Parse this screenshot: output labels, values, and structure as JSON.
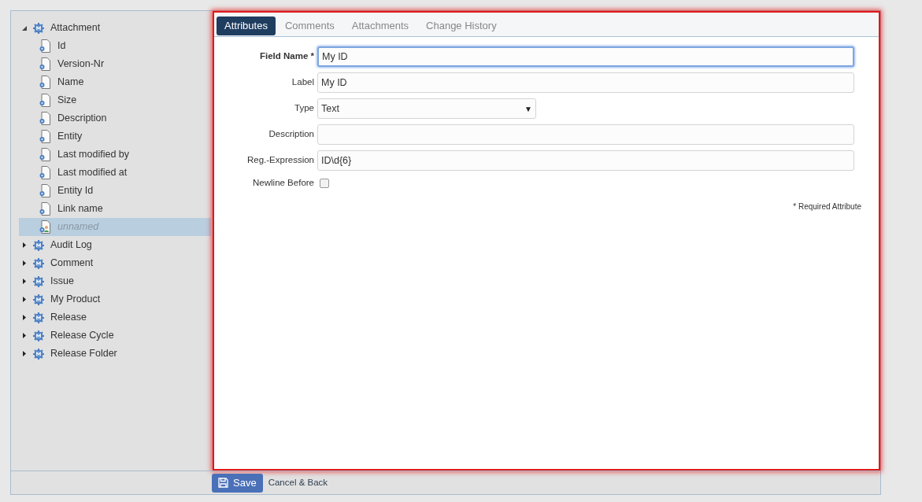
{
  "tree": [
    {
      "label": "Attachment",
      "kind": "entity",
      "expanded": true,
      "selected": false,
      "children": [
        {
          "label": "Id",
          "kind": "field",
          "selected": false
        },
        {
          "label": "Version-Nr",
          "kind": "field",
          "selected": false
        },
        {
          "label": "Name",
          "kind": "field",
          "selected": false
        },
        {
          "label": "Size",
          "kind": "field",
          "selected": false
        },
        {
          "label": "Description",
          "kind": "field",
          "selected": false
        },
        {
          "label": "Entity",
          "kind": "field",
          "selected": false
        },
        {
          "label": "Last modified by",
          "kind": "field",
          "selected": false
        },
        {
          "label": "Last modified at",
          "kind": "field",
          "selected": false
        },
        {
          "label": "Entity Id",
          "kind": "field",
          "selected": false
        },
        {
          "label": "Link name",
          "kind": "field",
          "selected": false
        },
        {
          "label": "unnamed",
          "kind": "new",
          "selected": true
        }
      ]
    },
    {
      "label": "Audit Log",
      "kind": "entity",
      "expanded": false,
      "selected": false
    },
    {
      "label": "Comment",
      "kind": "entity",
      "expanded": false,
      "selected": false
    },
    {
      "label": "Issue",
      "kind": "entity",
      "expanded": false,
      "selected": false
    },
    {
      "label": "My Product",
      "kind": "entity",
      "expanded": false,
      "selected": false
    },
    {
      "label": "Release",
      "kind": "entity",
      "expanded": false,
      "selected": false
    },
    {
      "label": "Release Cycle",
      "kind": "entity",
      "expanded": false,
      "selected": false
    },
    {
      "label": "Release Folder",
      "kind": "entity",
      "expanded": false,
      "selected": false
    }
  ],
  "tabs": [
    {
      "label": "Attributes",
      "selected": true
    },
    {
      "label": "Comments",
      "selected": false
    },
    {
      "label": "Attachments",
      "selected": false
    },
    {
      "label": "Change History",
      "selected": false
    }
  ],
  "form": [
    {
      "label": "Field Name *",
      "kind": "text",
      "value": "My ID",
      "required": true,
      "focused": true
    },
    {
      "label": "Label",
      "kind": "text",
      "value": "My ID"
    },
    {
      "label": "Type",
      "kind": "select",
      "value": "Text",
      "caret": "▼"
    },
    {
      "label": "Description",
      "kind": "text"
    },
    {
      "label": "Reg.-Expression",
      "kind": "text",
      "value": "ID\\d{6}"
    },
    {
      "label": "Newline Before",
      "kind": "checkbox",
      "checked": false
    }
  ],
  "required_note": "* Required Attribute",
  "footer": {
    "save": "Save",
    "cancel": "Cancel & Back"
  }
}
